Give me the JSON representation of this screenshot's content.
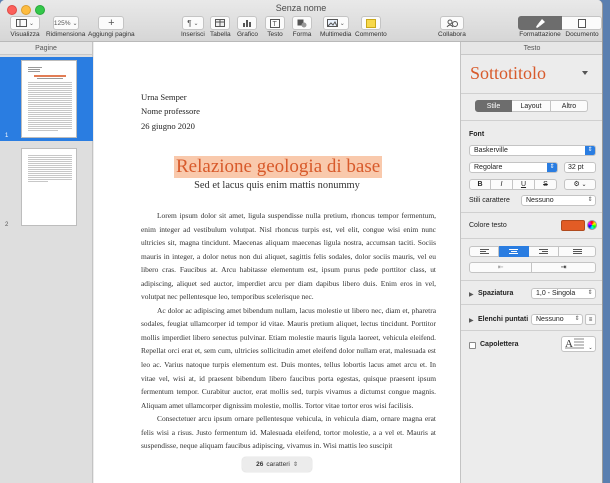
{
  "window": {
    "title": "Senza nome"
  },
  "colors": {
    "accent": "#2a7de1",
    "title_color": "#d85a2b",
    "title_highlight": "#f9c9ac",
    "text_color_well": "#e25c25"
  },
  "toolbar": {
    "view_label": "Visualizza",
    "zoom_value": "125%",
    "zoom_label": "Ridimensiona",
    "add_page_label": "Aggiungi pagina",
    "insert_label": "Inserisci",
    "table_label": "Tabella",
    "chart_label": "Grafico",
    "text_label": "Testo",
    "shape_label": "Forma",
    "media_label": "Multimedia",
    "comment_label": "Commento",
    "collaborate_label": "Collabora",
    "format_label": "Formattazione",
    "document_label": "Documento"
  },
  "sidebar": {
    "header": "Pagine",
    "pages": [
      {
        "number": "1"
      },
      {
        "number": "2"
      }
    ]
  },
  "document": {
    "sender": [
      "Urna Semper",
      "Nome professore",
      "26 giugno 2020"
    ],
    "title": "Relazione geologia di base",
    "subtitle": "Sed et lacus quis enim mattis nonummy",
    "paragraphs": [
      "Lorem ipsum dolor sit amet, ligula suspendisse nulla pretium, rhoncus tempor fermentum, enim integer ad vestibulum volutpat. Nisl rhoncus turpis est, vel elit, congue wisi enim nunc ultricies sit, magna tincidunt. Maecenas aliquam maecenas ligula nostra, accumsan taciti. Sociis mauris in integer, a dolor netus non dui aliquet, sagittis felis sodales, dolor sociis mauris, vel eu libero cras. Faucibus at. Arcu habitasse elementum est, ipsum purus pede porttitor class, ut adipiscing, aliquet sed auctor, imperdiet arcu per diam dapibus libero duis. Enim eros in vel, volutpat nec pellentesque leo, temporibus scelerisque nec.",
      "Ac dolor ac adipiscing amet bibendum nullam, lacus molestie ut libero nec, diam et, pharetra sodales, feugiat ullamcorper id tempor id vitae. Mauris pretium aliquet, lectus tincidunt. Porttitor mollis imperdiet libero senectus pulvinar. Etiam molestie mauris ligula laoreet, vehicula eleifend. Repellat orci erat et, sem cum, ultricies sollicitudin amet eleifend dolor nullam erat, malesuada est leo ac. Varius natoque turpis elementum est. Duis montes, tellus lobortis lacus amet arcu et. In vitae vel, wisi at, id praesent bibendum libero faucibus porta egestas, quisque praesent ipsum fermentum tempor. Curabitur auctor, erat mollis sed, turpis vivamus a dictumst congue magnis. Aliquam amet ullamcorper dignissim molestie, mollis. Tortor vitae tortor eros wisi facilisis.",
      "Consectetuer arcu ipsum ornare pellentesque vehicula, in vehicula diam, ornare magna erat felis wisi a risus. Justo fermentum id. Malesuada eleifend, tortor molestie, a a vel et. Mauris at suspendisse, neque aliquam faucibus adipiscing, vivamus in. Wisi mattis leo suscipit"
    ],
    "word_count_value": "26",
    "word_count_unit": "caratteri"
  },
  "inspector": {
    "header": "Testo",
    "paragraph_style": "Sottotitolo",
    "tabs": [
      "Stile",
      "Layout",
      "Altro"
    ],
    "font_section": "Font",
    "font_family": "Baskerville",
    "font_weight": "Regolare",
    "font_size": "32 pt",
    "bold": "B",
    "italic": "I",
    "underline": "U",
    "strike": "S",
    "char_styles_label": "Stili carattere",
    "char_styles_value": "Nessuno",
    "text_color_label": "Colore testo",
    "spacing_label": "Spaziatura",
    "spacing_value": "1,0 - Singola",
    "bullets_label": "Elenchi puntati",
    "bullets_value": "Nessuno",
    "dropcap_label": "Capolettera"
  }
}
